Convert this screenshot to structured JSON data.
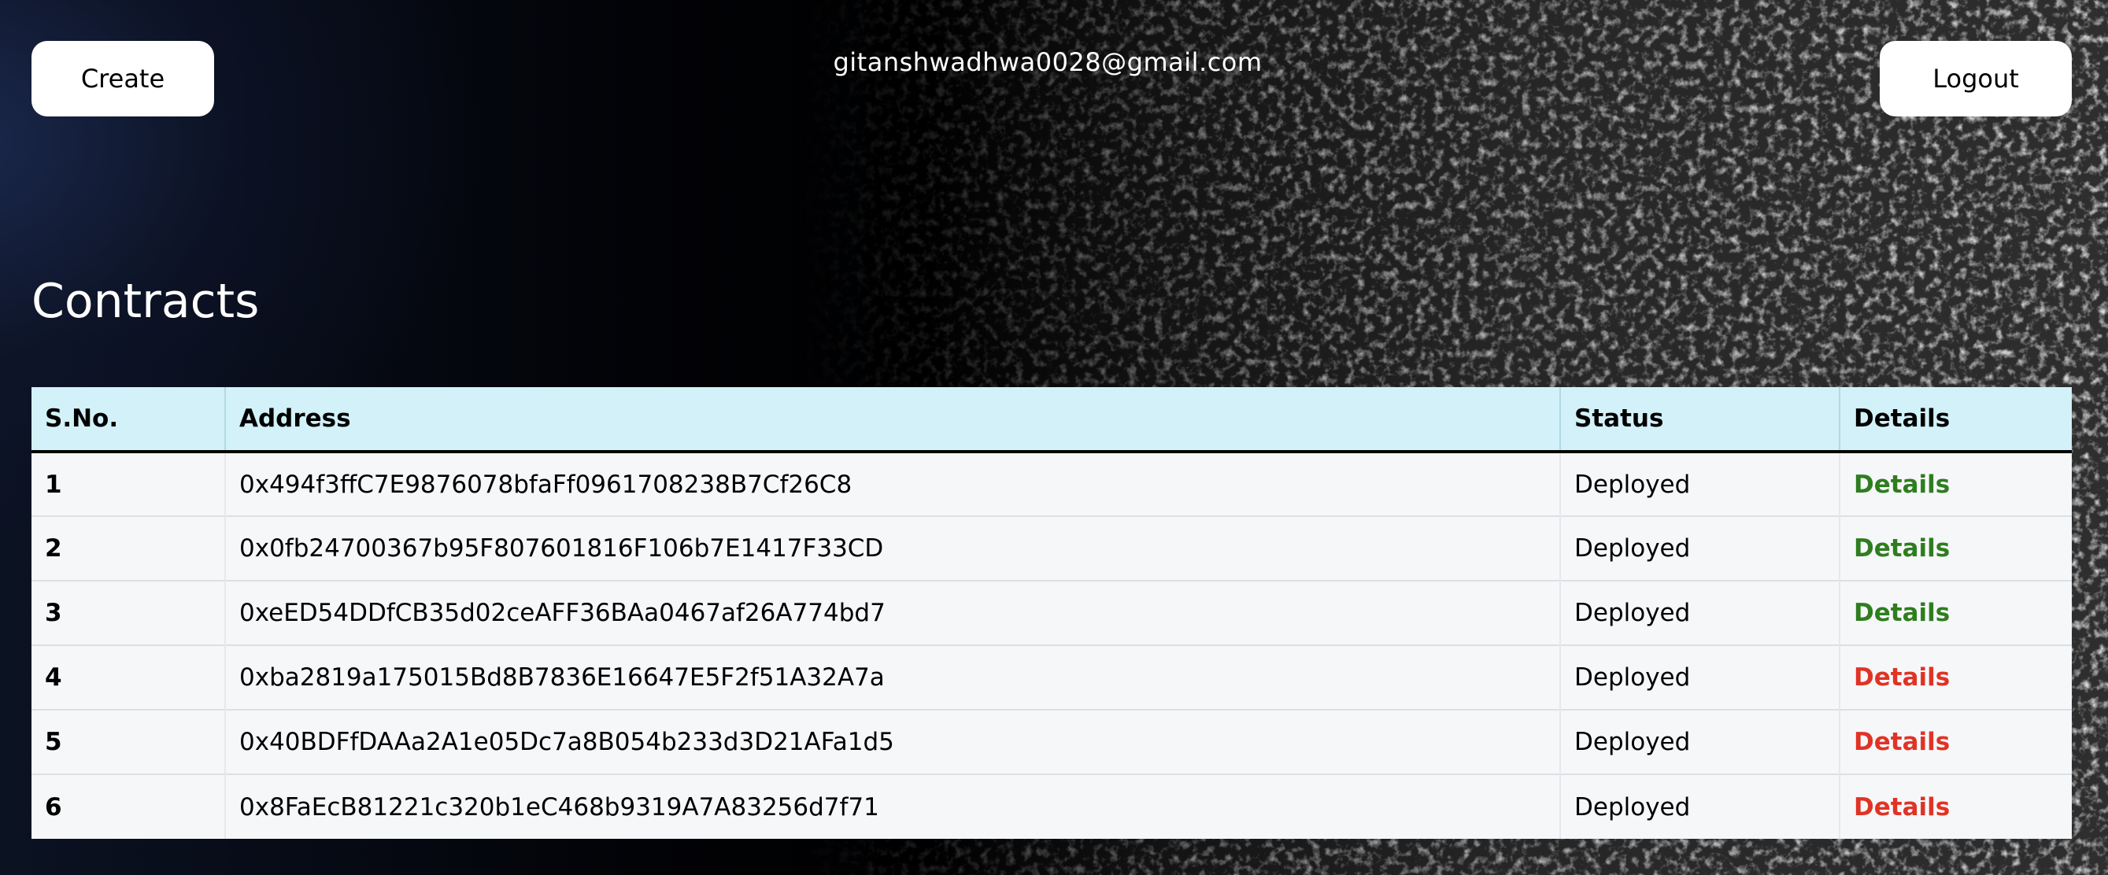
{
  "header": {
    "create_label": "Create",
    "user_email": "gitanshwadhwa0028@gmail.com",
    "logout_label": "Logout"
  },
  "main": {
    "title": "Contracts",
    "table": {
      "columns": [
        "S.No.",
        "Address",
        "Status",
        "Details"
      ],
      "rows": [
        {
          "sno": "1",
          "address": "0x494f3ffC7E9876078bfaFf0961708238B7Cf26C8",
          "status": "Deployed",
          "details": "Details",
          "details_color": "#2e7d1f"
        },
        {
          "sno": "2",
          "address": "0x0fb24700367b95F807601816F106b7E1417F33CD",
          "status": "Deployed",
          "details": "Details",
          "details_color": "#2e7d1f"
        },
        {
          "sno": "3",
          "address": "0xeED54DDfCB35d02ceAFF36BAa0467af26A774bd7",
          "status": "Deployed",
          "details": "Details",
          "details_color": "#2e7d1f"
        },
        {
          "sno": "4",
          "address": "0xba2819a175015Bd8B7836E16647E5F2f51A32A7a",
          "status": "Deployed",
          "details": "Details",
          "details_color": "#e03325"
        },
        {
          "sno": "5",
          "address": "0x40BDFfDAAa2A1e05Dc7a8B054b233d3D21AFa1d5",
          "status": "Deployed",
          "details": "Details",
          "details_color": "#e03325"
        },
        {
          "sno": "6",
          "address": "0x8FaEcB81221c320b1eC468b9319A7A83256d7f71",
          "status": "Deployed",
          "details": "Details",
          "details_color": "#e03325"
        }
      ]
    }
  },
  "colors": {
    "header_row_bg": "#d2f1f8",
    "row_bg": "#f6f7f9",
    "details_green": "#2e7d1f",
    "details_red": "#e03325"
  }
}
